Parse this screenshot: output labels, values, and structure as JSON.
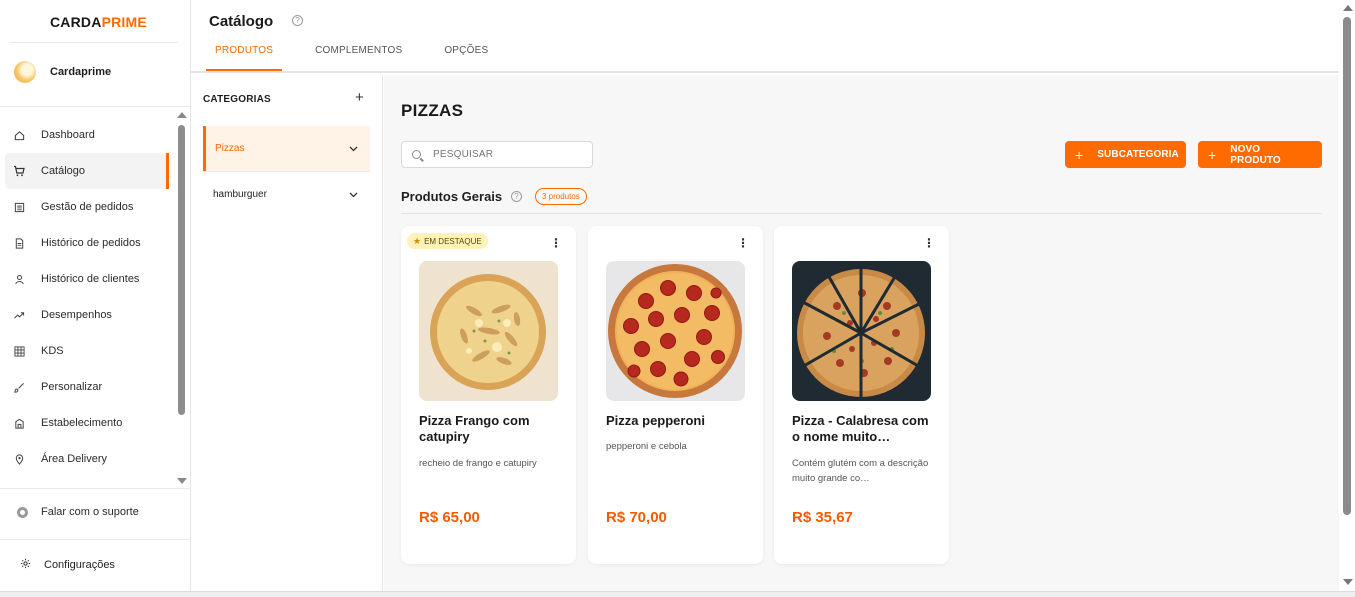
{
  "brand": {
    "part1": "CARDA",
    "part2": "PRIME",
    "accent": "#ff6b00"
  },
  "account": {
    "name": "Cardaprime"
  },
  "sidebar": {
    "items": [
      {
        "label": "Dashboard",
        "icon": "home-icon"
      },
      {
        "label": "Catálogo",
        "icon": "cart-icon",
        "active": true
      },
      {
        "label": "Gestão de pedidos",
        "icon": "list-icon"
      },
      {
        "label": "Histórico de pedidos",
        "icon": "document-icon"
      },
      {
        "label": "Histórico de clientes",
        "icon": "user-icon"
      },
      {
        "label": "Desempenhos",
        "icon": "trend-icon"
      },
      {
        "label": "KDS",
        "icon": "grid-icon"
      },
      {
        "label": "Personalizar",
        "icon": "brush-icon"
      },
      {
        "label": "Estabelecimento",
        "icon": "building-icon"
      },
      {
        "label": "Área Delivery",
        "icon": "map-pin-icon"
      }
    ],
    "support": "Falar com o suporte",
    "settings": "Configurações"
  },
  "header": {
    "title": "Catálogo",
    "tabs": [
      {
        "label": "PRODUTOS",
        "active": true
      },
      {
        "label": "COMPLEMENTOS"
      },
      {
        "label": "OPÇÕES"
      }
    ]
  },
  "categories": {
    "heading": "CATEGORIAS",
    "add": "+",
    "items": [
      {
        "label": "Pizzas",
        "active": true
      },
      {
        "label": "hamburguer"
      }
    ]
  },
  "main": {
    "title": "PIZZAS",
    "search_placeholder": "PESQUISAR",
    "btn_subcategory": "SUBCATEGORIA",
    "btn_new_product": "NOVO PRODUTO",
    "group_title": "Produtos Gerais",
    "group_count": "3 produtos",
    "featured_label": "EM DESTAQUE",
    "products": [
      {
        "name": "Pizza Frango com catupiry",
        "description": "recheio de frango e catupiry",
        "price": "R$ 65,00",
        "featured": true
      },
      {
        "name": "Pizza pepperoni",
        "description": "pepperoni e cebola",
        "price": "R$ 70,00"
      },
      {
        "name": "Pizza - Calabresa com o nome muito…",
        "description": "Contém glutém com a descrição muito grande co…",
        "price": "R$ 35,67"
      }
    ]
  }
}
